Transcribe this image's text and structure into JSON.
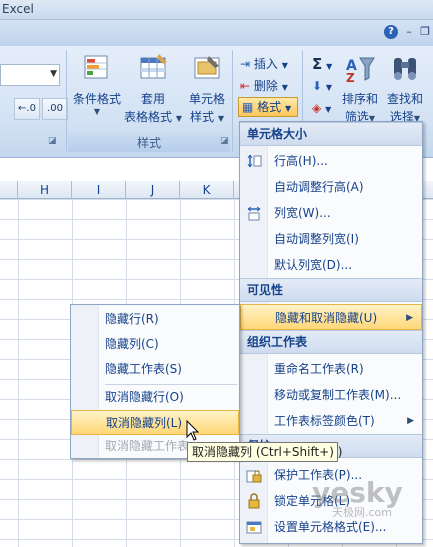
{
  "window": {
    "title": "Excel"
  },
  "ribbon": {
    "conditional_format": "条件格式",
    "table_format_line1": "套用",
    "table_format_line2": "表格格式",
    "cell_style_line1": "单元格",
    "cell_style_line2": "样式",
    "styles_group": "样式",
    "insert": "插入",
    "delete": "删除",
    "format": "格式",
    "sort_line1": "排序和",
    "sort_line2": "筛选",
    "find_line1": "查找和",
    "find_line2": "选择",
    "sigma": "Σ",
    "dec_inc": "←.0 .00",
    "dec_dec": ".00 →.0"
  },
  "columns": [
    "H",
    "I",
    "J",
    "K"
  ],
  "format_menu": {
    "section_cell_size": "单元格大小",
    "row_height": "行高(H)...",
    "autofit_row": "自动调整行高(A)",
    "col_width": "列宽(W)...",
    "autofit_col": "自动调整列宽(I)",
    "default_width": "默认列宽(D)...",
    "section_visibility": "可见性",
    "hide_unhide": "隐藏和取消隐藏(U)",
    "section_organize": "组织工作表",
    "rename_sheet": "重命名工作表(R)",
    "move_copy": "移动或复制工作表(M)...",
    "tab_color": "工作表标签颜色(T)",
    "section_protect": "保护",
    "protect_sheet": "保护工作表(P)...",
    "lock_cell": "锁定单元格(L)",
    "format_cells": "设置单元格格式(E)..."
  },
  "submenu": {
    "hide_rows": "隐藏行(R)",
    "hide_cols": "隐藏列(C)",
    "hide_sheet": "隐藏工作表(S)",
    "unhide_rows": "取消隐藏行(O)",
    "unhide_cols": "取消隐藏列(L)",
    "unhide_sheet": "取消隐藏工作表"
  },
  "tooltip": "取消隐藏列 (Ctrl+Shift+) )",
  "watermark": {
    "brand": "yesky",
    "sub": "天极网.com"
  },
  "colors": {
    "accent": "#15428b",
    "highlight": "#ffd777",
    "ribbon": "#d2e1f3"
  }
}
